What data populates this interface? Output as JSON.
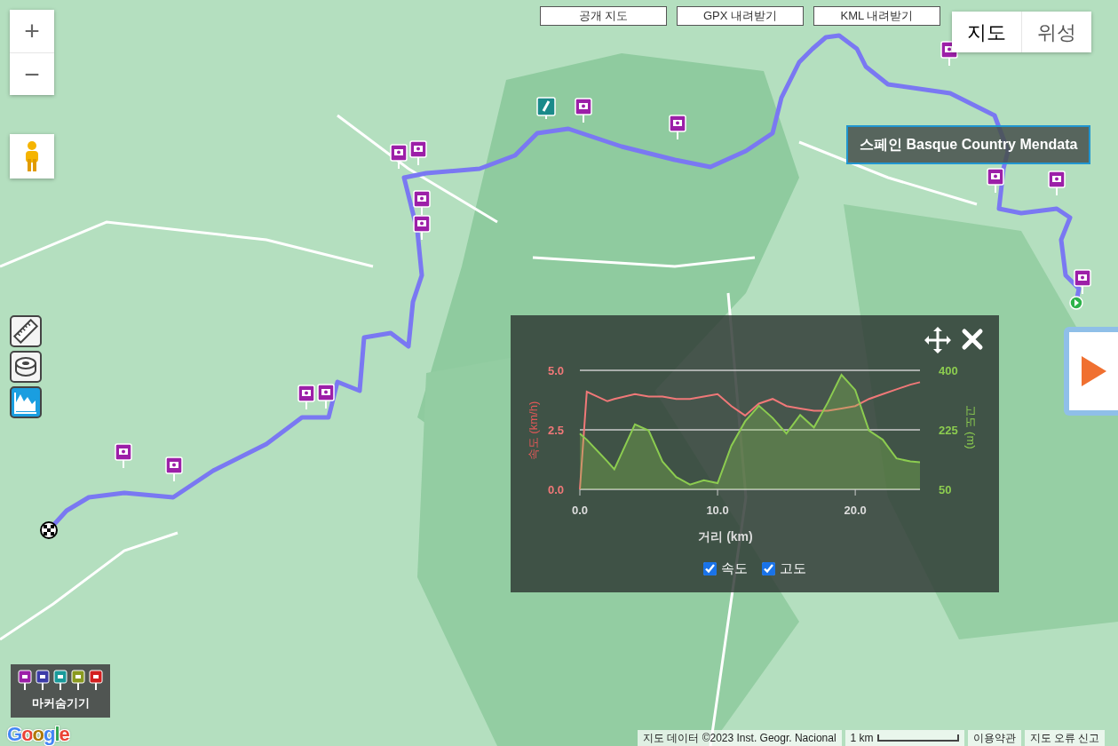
{
  "top_buttons": [
    "공개 지도",
    "GPX 내려받기",
    "KML 내려받기"
  ],
  "map_type_buttons": [
    {
      "label": "지도",
      "selected": true
    },
    {
      "label": "위성",
      "selected": false
    }
  ],
  "zoom": {
    "in": "+",
    "out": "−"
  },
  "title": "스페인 Basque Country Mendata",
  "tools": [
    {
      "selected": false
    },
    {
      "selected": false
    },
    {
      "selected": true
    }
  ],
  "marker_legend": {
    "markers": [
      {
        "color": "#9c1fa8"
      },
      {
        "color": "#3c3ca8"
      },
      {
        "color": "#1a9a9a"
      },
      {
        "color": "#8a9a20"
      },
      {
        "color": "#d32020"
      }
    ],
    "label": "마커숨기기"
  },
  "google_logo": "Google",
  "attribution": {
    "map_data": "지도 데이터 ©2023 Inst. Geogr. Nacional",
    "scale": "1 km",
    "terms": "이용약관",
    "report": "지도 오류 신고"
  },
  "elevation_panel": {
    "series_toggles": [
      {
        "checked": true
      },
      {
        "checked": true
      }
    ],
    "chart_data": {
      "type": "line",
      "xlabel": "거리 (km)",
      "ylabel": "속도 (km/h)",
      "y2label": "고도 (m)",
      "x": [
        0,
        0.5,
        2,
        2.5,
        4,
        5,
        6,
        7,
        8,
        9,
        10,
        11,
        12,
        13,
        14,
        15,
        16,
        17,
        18,
        19,
        20,
        21,
        22,
        23,
        24,
        24.7
      ],
      "series": [
        {
          "name": "속도",
          "color": "#f07878",
          "axis": "y",
          "values": [
            0,
            4.1,
            3.7,
            3.8,
            4.0,
            3.9,
            3.9,
            3.8,
            3.8,
            3.9,
            4.0,
            3.5,
            3.1,
            3.6,
            3.8,
            3.5,
            3.4,
            3.3,
            3.3,
            3.4,
            3.5,
            3.8,
            4.0,
            4.2,
            4.4,
            4.5
          ]
        },
        {
          "name": "고도",
          "color": "#8ccc50",
          "axis": "y2",
          "type": "area",
          "values": [
            214,
            196,
            132,
            109,
            241,
            223,
            132,
            86,
            64,
            77,
            68,
            178,
            250,
            296,
            260,
            214,
            269,
            232,
            305,
            387,
            342,
            223,
            196,
            141,
            132,
            130
          ]
        }
      ],
      "xlim": [
        0,
        24.7
      ],
      "ylim": [
        0,
        5
      ],
      "y2lim": [
        50,
        400
      ],
      "xticks": [
        {
          "value": 0,
          "label": "0.0"
        },
        {
          "value": 10,
          "label": "10.0"
        },
        {
          "value": 20,
          "label": "20.0"
        }
      ],
      "yticks": [
        {
          "value": 0,
          "label": "0.0"
        },
        {
          "value": 2.5,
          "label": "2.5"
        },
        {
          "value": 5,
          "label": "5.0"
        }
      ],
      "y2ticks": [
        {
          "value": 50,
          "label": "50"
        },
        {
          "value": 225,
          "label": "225"
        },
        {
          "value": 400,
          "label": "400"
        }
      ]
    }
  }
}
